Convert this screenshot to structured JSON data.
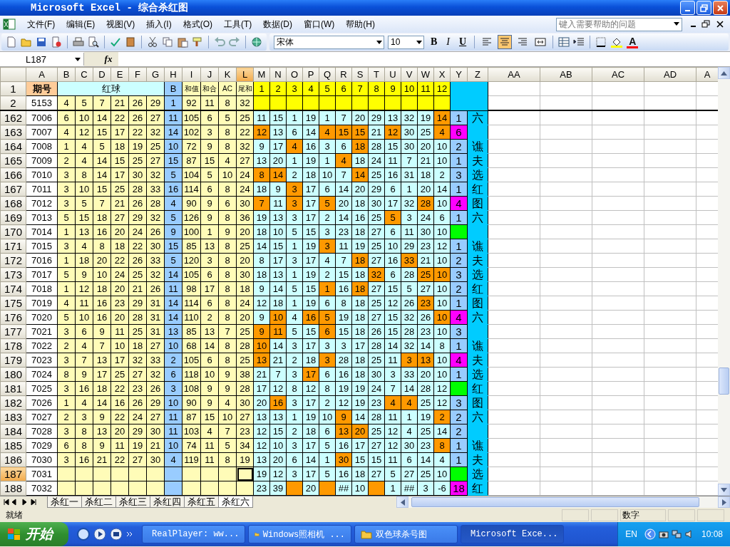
{
  "window": {
    "title": "Microsoft Excel - 综合杀红图"
  },
  "menu": [
    "文件(F)",
    "编辑(E)",
    "视图(V)",
    "插入(I)",
    "格式(O)",
    "工具(T)",
    "数据(D)",
    "窗口(W)",
    "帮助(H)"
  ],
  "help_search": {
    "placeholder": "键入需要帮助的问题"
  },
  "format_toolbar": {
    "font": "宋体",
    "size": "10",
    "style_buttons": [
      {
        "label": "B",
        "kind": "bold"
      },
      {
        "label": "I",
        "kind": "italic"
      },
      {
        "label": "U",
        "kind": "underline"
      }
    ],
    "alignment": [
      {
        "kind": "left",
        "selected": false
      },
      {
        "kind": "center",
        "selected": true
      },
      {
        "kind": "right",
        "selected": false
      },
      {
        "kind": "merge",
        "selected": false
      }
    ],
    "font_color_label": "A"
  },
  "name_box": "L187",
  "formula_label": "fx",
  "columns": [
    {
      "label": "A",
      "selected": false
    },
    {
      "label": "B",
      "selected": false
    },
    {
      "label": "C",
      "selected": false
    },
    {
      "label": "D",
      "selected": false
    },
    {
      "label": "E",
      "selected": false
    },
    {
      "label": "F",
      "selected": false
    },
    {
      "label": "G",
      "selected": false
    },
    {
      "label": "H",
      "selected": false
    },
    {
      "label": "I",
      "selected": false
    },
    {
      "label": "J",
      "selected": false
    },
    {
      "label": "K",
      "selected": false
    },
    {
      "label": "L",
      "selected": true
    },
    {
      "label": "M",
      "selected": false
    },
    {
      "label": "N",
      "selected": false
    },
    {
      "label": "O",
      "selected": false
    },
    {
      "label": "P",
      "selected": false
    },
    {
      "label": "Q",
      "selected": false
    },
    {
      "label": "R",
      "selected": false
    },
    {
      "label": "S",
      "selected": false
    },
    {
      "label": "T",
      "selected": false
    },
    {
      "label": "U",
      "selected": false
    },
    {
      "label": "V",
      "selected": false
    },
    {
      "label": "W",
      "selected": false
    },
    {
      "label": "X",
      "selected": false
    },
    {
      "label": "Y",
      "selected": false
    },
    {
      "label": "Z",
      "selected": false
    },
    {
      "label": "AA",
      "selected": false
    },
    {
      "label": "AB",
      "selected": false
    },
    {
      "label": "AC",
      "selected": false
    },
    {
      "label": "AD",
      "selected": false
    },
    {
      "label": "A",
      "selected": false
    }
  ],
  "header_row": {
    "number": "1",
    "period_label": "期号",
    "red_label": "红球",
    "blue_label": "B",
    "stat_labels": [
      "和值",
      "和合",
      "AC",
      "尾和"
    ],
    "positions": [
      "1",
      "2",
      "3",
      "4",
      "5",
      "6",
      "7",
      "8",
      "9",
      "10",
      "11",
      "12"
    ]
  },
  "base_row": {
    "number": "2",
    "period": "5153",
    "reds": [
      "4",
      "5",
      "7",
      "21",
      "26",
      "29"
    ],
    "blue": "1",
    "stats": [
      "92",
      "11",
      "8",
      "32"
    ]
  },
  "rows": [
    {
      "number": "162",
      "period": "7006",
      "reds": [
        "6",
        "10",
        "14",
        "22",
        "26",
        "27"
      ],
      "blue": "11",
      "stats": [
        "105",
        "6",
        "5",
        "25"
      ],
      "picks": [
        "11",
        "15",
        "1",
        "19",
        "1",
        "7",
        "20",
        "29",
        "13",
        "32",
        "19",
        "14"
      ],
      "hits": [
        false,
        false,
        false,
        false,
        false,
        false,
        false,
        false,
        false,
        false,
        false,
        true
      ],
      "count": "1",
      "mark": "六",
      "selected": false
    },
    {
      "number": "163",
      "period": "7007",
      "reds": [
        "4",
        "12",
        "15",
        "17",
        "22",
        "32"
      ],
      "blue": "14",
      "stats": [
        "102",
        "3",
        "8",
        "22"
      ],
      "picks": [
        "12",
        "13",
        "6",
        "14",
        "4",
        "15",
        "15",
        "21",
        "12",
        "30",
        "25",
        "4"
      ],
      "hits": [
        true,
        false,
        false,
        false,
        true,
        true,
        true,
        false,
        true,
        false,
        false,
        true
      ],
      "count": "6",
      "color": "#ff00ff",
      "selected": false
    },
    {
      "number": "164",
      "period": "7008",
      "reds": [
        "1",
        "4",
        "5",
        "18",
        "19",
        "25"
      ],
      "blue": "10",
      "stats": [
        "72",
        "9",
        "8",
        "32"
      ],
      "picks": [
        "9",
        "17",
        "4",
        "16",
        "3",
        "6",
        "18",
        "28",
        "15",
        "30",
        "20",
        "10"
      ],
      "hits": [
        false,
        false,
        true,
        false,
        false,
        false,
        true,
        false,
        false,
        false,
        false,
        false
      ],
      "count": "2",
      "mark": "谯",
      "selected": false
    },
    {
      "number": "165",
      "period": "7009",
      "reds": [
        "2",
        "4",
        "14",
        "15",
        "25",
        "27"
      ],
      "blue": "15",
      "stats": [
        "87",
        "15",
        "4",
        "27"
      ],
      "picks": [
        "13",
        "20",
        "1",
        "19",
        "1",
        "4",
        "18",
        "24",
        "11",
        "7",
        "21",
        "10"
      ],
      "hits": [
        false,
        false,
        false,
        false,
        false,
        true,
        false,
        false,
        false,
        false,
        false,
        false
      ],
      "count": "1",
      "mark": "夫",
      "selected": false
    },
    {
      "number": "166",
      "period": "7010",
      "reds": [
        "3",
        "8",
        "14",
        "17",
        "30",
        "32"
      ],
      "blue": "5",
      "stats": [
        "104",
        "5",
        "10",
        "24"
      ],
      "picks": [
        "8",
        "14",
        "2",
        "18",
        "10",
        "7",
        "14",
        "25",
        "16",
        "31",
        "18",
        "2"
      ],
      "hits": [
        true,
        true,
        false,
        false,
        false,
        false,
        true,
        false,
        false,
        false,
        false,
        false
      ],
      "count": "3",
      "mark": "选",
      "selected": false
    },
    {
      "number": "167",
      "period": "7011",
      "reds": [
        "3",
        "10",
        "15",
        "25",
        "28",
        "33"
      ],
      "blue": "16",
      "stats": [
        "114",
        "6",
        "8",
        "24"
      ],
      "picks": [
        "18",
        "9",
        "3",
        "17",
        "6",
        "14",
        "20",
        "29",
        "6",
        "1",
        "20",
        "14"
      ],
      "hits": [
        false,
        false,
        true,
        false,
        false,
        false,
        false,
        false,
        false,
        false,
        false,
        false
      ],
      "count": "1",
      "mark": "红",
      "selected": false
    },
    {
      "number": "168",
      "period": "7012",
      "reds": [
        "3",
        "5",
        "7",
        "21",
        "26",
        "28"
      ],
      "blue": "4",
      "stats": [
        "90",
        "9",
        "6",
        "30"
      ],
      "picks": [
        "7",
        "11",
        "3",
        "17",
        "5",
        "20",
        "18",
        "30",
        "17",
        "32",
        "28",
        "10"
      ],
      "hits": [
        true,
        false,
        true,
        false,
        true,
        false,
        false,
        false,
        false,
        false,
        true,
        false
      ],
      "count": "4",
      "color": "#ff00ff",
      "mark": "图",
      "selected": false
    },
    {
      "number": "169",
      "period": "7013",
      "reds": [
        "5",
        "15",
        "18",
        "27",
        "29",
        "32"
      ],
      "blue": "5",
      "stats": [
        "126",
        "9",
        "8",
        "36"
      ],
      "picks": [
        "19",
        "13",
        "3",
        "17",
        "2",
        "14",
        "16",
        "25",
        "5",
        "3",
        "24",
        "6"
      ],
      "hits": [
        false,
        false,
        false,
        false,
        false,
        false,
        false,
        false,
        true,
        false,
        false,
        false
      ],
      "count": "1",
      "mark": "六",
      "selected": false
    },
    {
      "number": "170",
      "period": "7014",
      "reds": [
        "1",
        "13",
        "16",
        "20",
        "24",
        "26"
      ],
      "blue": "9",
      "stats": [
        "100",
        "1",
        "9",
        "20"
      ],
      "picks": [
        "18",
        "10",
        "5",
        "15",
        "3",
        "23",
        "18",
        "27",
        "6",
        "11",
        "30",
        "10"
      ],
      "hits": [
        false,
        false,
        false,
        false,
        false,
        false,
        false,
        false,
        false,
        false,
        false,
        false
      ],
      "color": "#00ff00",
      "selected": false
    },
    {
      "number": "171",
      "period": "7015",
      "reds": [
        "3",
        "4",
        "8",
        "18",
        "22",
        "30"
      ],
      "blue": "15",
      "stats": [
        "85",
        "13",
        "8",
        "25"
      ],
      "picks": [
        "14",
        "15",
        "1",
        "19",
        "3",
        "11",
        "19",
        "25",
        "10",
        "29",
        "23",
        "12"
      ],
      "hits": [
        false,
        false,
        false,
        false,
        true,
        false,
        false,
        false,
        false,
        false,
        false,
        false
      ],
      "count": "1",
      "mark": "谯",
      "selected": false
    },
    {
      "number": "172",
      "period": "7016",
      "reds": [
        "1",
        "18",
        "20",
        "22",
        "26",
        "33"
      ],
      "blue": "5",
      "stats": [
        "120",
        "3",
        "8",
        "20"
      ],
      "picks": [
        "8",
        "17",
        "3",
        "17",
        "4",
        "7",
        "18",
        "27",
        "16",
        "33",
        "21",
        "10"
      ],
      "hits": [
        false,
        false,
        false,
        false,
        false,
        false,
        true,
        false,
        false,
        true,
        false,
        false
      ],
      "count": "2",
      "mark": "夫",
      "selected": false
    },
    {
      "number": "173",
      "period": "7017",
      "reds": [
        "5",
        "9",
        "10",
        "24",
        "25",
        "32"
      ],
      "blue": "14",
      "stats": [
        "105",
        "6",
        "8",
        "30"
      ],
      "picks": [
        "18",
        "13",
        "1",
        "19",
        "2",
        "15",
        "18",
        "32",
        "6",
        "28",
        "25",
        "10"
      ],
      "hits": [
        false,
        false,
        false,
        false,
        false,
        false,
        false,
        true,
        false,
        false,
        true,
        true
      ],
      "count": "3",
      "mark": "选",
      "selected": false
    },
    {
      "number": "174",
      "period": "7018",
      "reds": [
        "1",
        "12",
        "18",
        "20",
        "21",
        "26"
      ],
      "blue": "11",
      "stats": [
        "98",
        "17",
        "8",
        "18"
      ],
      "picks": [
        "9",
        "14",
        "5",
        "15",
        "1",
        "16",
        "18",
        "27",
        "15",
        "5",
        "27",
        "10"
      ],
      "hits": [
        false,
        false,
        false,
        false,
        true,
        false,
        true,
        false,
        false,
        false,
        false,
        false
      ],
      "count": "2",
      "mark": "红",
      "selected": false
    },
    {
      "number": "175",
      "period": "7019",
      "reds": [
        "4",
        "11",
        "16",
        "23",
        "29",
        "31"
      ],
      "blue": "14",
      "stats": [
        "114",
        "6",
        "8",
        "24"
      ],
      "picks": [
        "12",
        "18",
        "1",
        "19",
        "6",
        "8",
        "18",
        "25",
        "12",
        "26",
        "23",
        "10"
      ],
      "hits": [
        false,
        false,
        false,
        false,
        false,
        false,
        false,
        false,
        false,
        false,
        true,
        false
      ],
      "count": "1",
      "mark": "图",
      "selected": false
    },
    {
      "number": "176",
      "period": "7020",
      "reds": [
        "5",
        "10",
        "16",
        "20",
        "28",
        "31"
      ],
      "blue": "14",
      "stats": [
        "110",
        "2",
        "8",
        "20"
      ],
      "picks": [
        "9",
        "10",
        "4",
        "16",
        "5",
        "19",
        "18",
        "27",
        "15",
        "32",
        "26",
        "10"
      ],
      "hits": [
        false,
        true,
        false,
        true,
        true,
        false,
        false,
        false,
        false,
        false,
        false,
        true
      ],
      "count": "4",
      "color": "#ff00ff",
      "mark": "六",
      "selected": false
    },
    {
      "number": "177",
      "period": "7021",
      "reds": [
        "3",
        "6",
        "9",
        "11",
        "25",
        "31"
      ],
      "blue": "13",
      "stats": [
        "85",
        "13",
        "7",
        "25"
      ],
      "picks": [
        "9",
        "11",
        "5",
        "15",
        "6",
        "15",
        "18",
        "26",
        "15",
        "28",
        "23",
        "10"
      ],
      "hits": [
        true,
        true,
        false,
        false,
        true,
        false,
        false,
        false,
        false,
        false,
        false,
        false
      ],
      "count": "3",
      "selected": false
    },
    {
      "number": "178",
      "period": "7022",
      "reds": [
        "2",
        "4",
        "7",
        "10",
        "18",
        "27"
      ],
      "blue": "10",
      "stats": [
        "68",
        "14",
        "8",
        "28"
      ],
      "picks": [
        "10",
        "14",
        "3",
        "17",
        "3",
        "3",
        "17",
        "28",
        "14",
        "32",
        "14",
        "8"
      ],
      "hits": [
        true,
        false,
        false,
        false,
        false,
        false,
        false,
        false,
        false,
        false,
        false,
        false
      ],
      "count": "1",
      "mark": "谯",
      "selected": false
    },
    {
      "number": "179",
      "period": "7023",
      "reds": [
        "3",
        "7",
        "13",
        "17",
        "32",
        "33"
      ],
      "blue": "2",
      "stats": [
        "105",
        "6",
        "8",
        "25"
      ],
      "picks": [
        "13",
        "21",
        "2",
        "18",
        "3",
        "28",
        "18",
        "25",
        "11",
        "3",
        "13",
        "10"
      ],
      "hits": [
        true,
        false,
        false,
        false,
        true,
        false,
        false,
        false,
        false,
        true,
        true,
        false
      ],
      "count": "4",
      "color": "#ff00ff",
      "mark": "夫",
      "selected": false
    },
    {
      "number": "180",
      "period": "7024",
      "reds": [
        "8",
        "9",
        "17",
        "25",
        "27",
        "32"
      ],
      "blue": "6",
      "stats": [
        "118",
        "10",
        "9",
        "38"
      ],
      "picks": [
        "21",
        "7",
        "3",
        "17",
        "6",
        "16",
        "18",
        "30",
        "3",
        "33",
        "20",
        "10"
      ],
      "hits": [
        false,
        false,
        false,
        true,
        false,
        false,
        false,
        false,
        false,
        false,
        false,
        false
      ],
      "count": "1",
      "mark": "选",
      "selected": false
    },
    {
      "number": "181",
      "period": "7025",
      "reds": [
        "3",
        "16",
        "18",
        "22",
        "23",
        "26"
      ],
      "blue": "3",
      "stats": [
        "108",
        "9",
        "9",
        "28"
      ],
      "picks": [
        "17",
        "12",
        "8",
        "12",
        "8",
        "19",
        "19",
        "24",
        "7",
        "14",
        "28",
        "12"
      ],
      "hits": [
        false,
        false,
        false,
        false,
        false,
        false,
        false,
        false,
        false,
        false,
        false,
        false
      ],
      "color": "#00ff00",
      "mark": "红",
      "selected": false
    },
    {
      "number": "182",
      "period": "7026",
      "reds": [
        "1",
        "4",
        "14",
        "16",
        "26",
        "29"
      ],
      "blue": "10",
      "stats": [
        "90",
        "9",
        "4",
        "30"
      ],
      "picks": [
        "20",
        "16",
        "3",
        "17",
        "2",
        "12",
        "19",
        "23",
        "4",
        "4",
        "25",
        "12"
      ],
      "hits": [
        false,
        true,
        false,
        false,
        false,
        false,
        false,
        false,
        true,
        true,
        false,
        false
      ],
      "count": "3",
      "mark": "图",
      "selected": false
    },
    {
      "number": "183",
      "period": "7027",
      "reds": [
        "2",
        "3",
        "9",
        "22",
        "24",
        "27"
      ],
      "blue": "11",
      "stats": [
        "87",
        "15",
        "10",
        "27"
      ],
      "picks": [
        "13",
        "13",
        "1",
        "19",
        "10",
        "9",
        "14",
        "28",
        "11",
        "1",
        "19",
        "2"
      ],
      "hits": [
        false,
        false,
        false,
        false,
        false,
        true,
        false,
        false,
        false,
        false,
        false,
        true
      ],
      "count": "2",
      "mark": "六",
      "selected": false
    },
    {
      "number": "184",
      "period": "7028",
      "reds": [
        "3",
        "8",
        "13",
        "20",
        "29",
        "30"
      ],
      "blue": "11",
      "stats": [
        "103",
        "4",
        "7",
        "23"
      ],
      "picks": [
        "12",
        "15",
        "2",
        "18",
        "6",
        "13",
        "20",
        "25",
        "12",
        "4",
        "25",
        "14"
      ],
      "hits": [
        false,
        false,
        false,
        false,
        false,
        true,
        true,
        false,
        false,
        false,
        false,
        false
      ],
      "count": "2",
      "selected": false
    },
    {
      "number": "185",
      "period": "7029",
      "reds": [
        "6",
        "8",
        "9",
        "11",
        "19",
        "21"
      ],
      "blue": "10",
      "stats": [
        "74",
        "11",
        "5",
        "34"
      ],
      "picks": [
        "12",
        "10",
        "3",
        "17",
        "5",
        "16",
        "17",
        "27",
        "12",
        "30",
        "23",
        "8"
      ],
      "hits": [
        false,
        false,
        false,
        false,
        false,
        false,
        false,
        false,
        false,
        false,
        false,
        true
      ],
      "count": "1",
      "mark": "谯",
      "selected": false
    },
    {
      "number": "186",
      "period": "7030",
      "reds": [
        "3",
        "16",
        "21",
        "22",
        "27",
        "30"
      ],
      "blue": "4",
      "stats": [
        "119",
        "11",
        "8",
        "19"
      ],
      "picks": [
        "13",
        "20",
        "6",
        "14",
        "1",
        "30",
        "15",
        "15",
        "11",
        "6",
        "14",
        "4"
      ],
      "hits": [
        false,
        false,
        false,
        false,
        false,
        true,
        false,
        false,
        false,
        false,
        false,
        false
      ],
      "count": "1",
      "mark": "夫",
      "selected": false
    },
    {
      "number": "187",
      "period": "7031",
      "reds": [],
      "stats": [],
      "picks": [
        "19",
        "12",
        "3",
        "17",
        "5",
        "16",
        "18",
        "27",
        "5",
        "27",
        "25",
        "10"
      ],
      "hits": [
        false,
        false,
        false,
        false,
        false,
        false,
        false,
        false,
        false,
        false,
        false,
        false
      ],
      "color": "#00ff00",
      "mark": "选",
      "selected": true
    },
    {
      "number": "188",
      "period": "7032",
      "reds": [],
      "stats": [],
      "picks": [
        "23",
        "39",
        {
          "kind": "blank"
        },
        "20",
        {
          "kind": "blank"
        },
        "##",
        "10",
        {
          "kind": "blank"
        },
        "1",
        "##",
        "3",
        "-6"
      ],
      "hits": [
        false,
        false,
        true,
        false,
        true,
        false,
        false,
        true,
        false,
        false,
        false,
        false
      ],
      "count": "18",
      "color": "#ff00ff",
      "mark": "红",
      "selected": false
    }
  ],
  "sheet_tabs": [
    {
      "label": "杀红一",
      "selected": false
    },
    {
      "label": "杀红二",
      "selected": false
    },
    {
      "label": "杀红三",
      "selected": false
    },
    {
      "label": "杀红四",
      "selected": false
    },
    {
      "label": "杀红五",
      "selected": false
    },
    {
      "label": "杀红六",
      "selected": true
    }
  ],
  "status_bar": {
    "state": "就绪",
    "mode": "数字"
  },
  "taskbar": {
    "start": "开始",
    "tasks": [
      {
        "label": "RealPlayer: ww...",
        "kind": "player",
        "selected": false
      },
      {
        "label": "Windows照相机 ...",
        "kind": "folder",
        "selected": false
      },
      {
        "label": "双色球杀号图",
        "kind": "folder",
        "selected": false
      },
      {
        "label": "Microsoft Exce...",
        "kind": "excel",
        "selected": true
      }
    ],
    "language": "EN",
    "clock": "10:08"
  }
}
